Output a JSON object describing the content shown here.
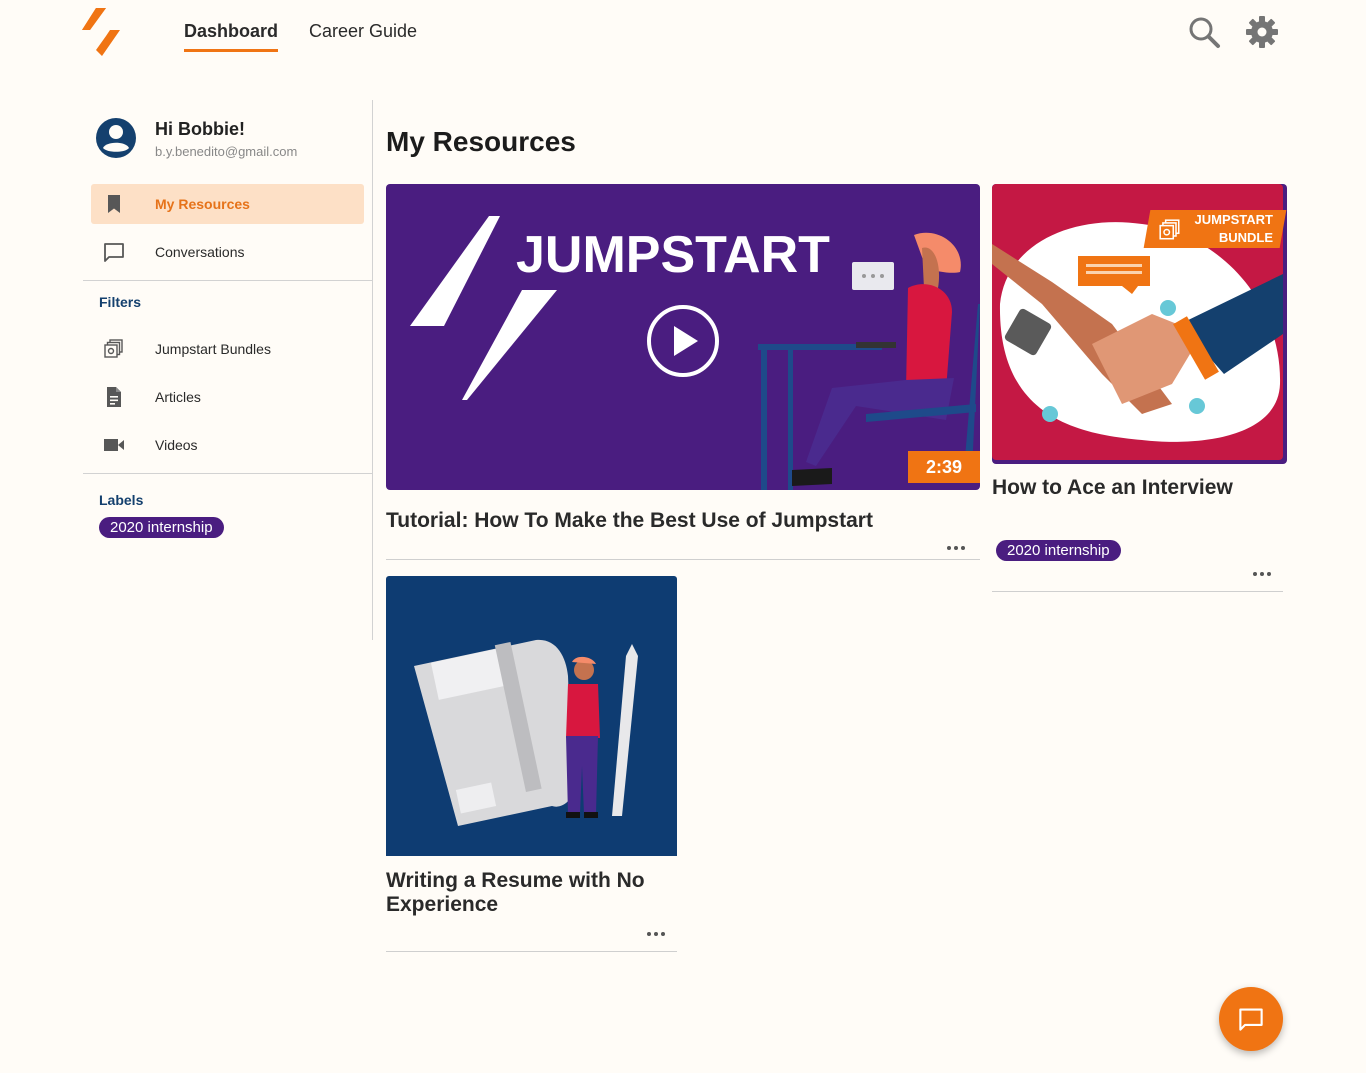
{
  "nav": {
    "tabs": [
      {
        "label": "Dashboard",
        "active": true
      },
      {
        "label": "Career Guide",
        "active": false
      }
    ],
    "icons": [
      "search-icon",
      "gear-icon"
    ]
  },
  "brand": {
    "accent": "#f07413",
    "purple": "#4a1d80",
    "navy": "#14406e"
  },
  "user": {
    "greeting": "Hi Bobbie!",
    "email": "b.y.benedito@gmail.com"
  },
  "sidebar": {
    "items": [
      {
        "label": "My Resources",
        "icon": "bookmark-icon",
        "active": true
      },
      {
        "label": "Conversations",
        "icon": "chat-icon",
        "active": false
      }
    ],
    "filters_title": "Filters",
    "filters": [
      {
        "label": "Jumpstart Bundles",
        "icon": "bundle-icon"
      },
      {
        "label": "Articles",
        "icon": "document-icon"
      },
      {
        "label": "Videos",
        "icon": "video-icon"
      }
    ],
    "labels_title": "Labels",
    "labels": [
      "2020 internship"
    ]
  },
  "main": {
    "title": "My Resources",
    "cards": [
      {
        "title": "Tutorial: How To Make the Best Use of Jumpstart",
        "thumb_text": "JUMPSTART",
        "duration": "2:39",
        "type": "video"
      },
      {
        "title": "How to Ace an Interview",
        "badge_line1": "JUMPSTART",
        "badge_line2": "BUNDLE",
        "label": "2020 internship",
        "type": "bundle"
      },
      {
        "title": "Writing a Resume with No Experience",
        "type": "article"
      }
    ]
  }
}
